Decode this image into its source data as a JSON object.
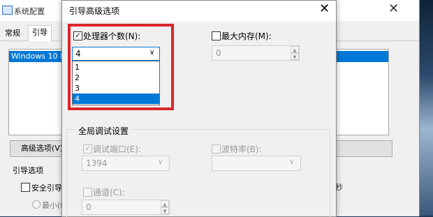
{
  "background_window": {
    "title": "系统配置",
    "tabs": [
      "常规",
      "引导"
    ],
    "os_entry": "Windows 10 E",
    "advanced_button": "高级选项(V)",
    "boot_options_label": "引导选项",
    "safe_boot_label": "安全引导(",
    "minimal_label": "最小(M",
    "seconds_fragment": "秒"
  },
  "dialog": {
    "title": "引导高级选项",
    "close_glyph": "✕",
    "processors": {
      "label": "处理器个数(N):",
      "checked": true,
      "selected_value": "4",
      "options": [
        "1",
        "2",
        "3",
        "4"
      ],
      "selected_index": 3
    },
    "max_memory": {
      "label": "最大内存(M):",
      "checked": false,
      "value": "0"
    },
    "debug": {
      "group_title": "全局调试设置",
      "debug_port_label": "调试端口(E):",
      "debug_port_checked": true,
      "debug_port_value": "1394",
      "baud_rate_label": "波特率(B):",
      "baud_rate_value": "",
      "channel_label": "通道(C):",
      "channel_value": "0"
    }
  },
  "colors": {
    "accent": "#0078d7",
    "highlight_box": "#d9262c"
  },
  "icons": {
    "chevron": "chevron-down-icon",
    "close": "close-icon",
    "spin_up": "spin-up-icon",
    "spin_down": "spin-down-icon"
  }
}
